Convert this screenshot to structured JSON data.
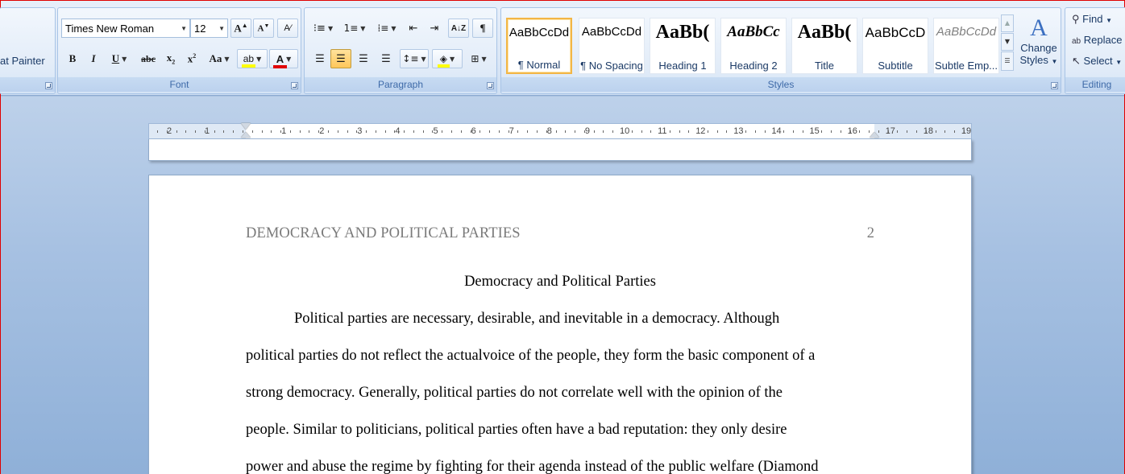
{
  "clipboard": {
    "format_painter_label": "at Painter"
  },
  "font": {
    "name": "Times New Roman",
    "size": "12",
    "group_label": "Font"
  },
  "paragraph": {
    "group_label": "Paragraph"
  },
  "styles": {
    "group_label": "Styles",
    "items": [
      {
        "sample": "AaBbCcDd",
        "name": "¶ Normal"
      },
      {
        "sample": "AaBbCcDd",
        "name": "¶ No Spacing"
      },
      {
        "sample": "AaBb(",
        "name": "Heading 1"
      },
      {
        "sample": "AaBbCc",
        "name": "Heading 2"
      },
      {
        "sample": "AaBb(",
        "name": "Title"
      },
      {
        "sample": "AaBbCcD",
        "name": "Subtitle"
      },
      {
        "sample": "AaBbCcDd",
        "name": "Subtle Emp..."
      }
    ],
    "change_styles_line1": "Change",
    "change_styles_line2": "Styles"
  },
  "editing": {
    "group_label": "Editing",
    "find": "Find",
    "replace": "Replace",
    "select": "Select"
  },
  "ruler": {
    "left_labels": [
      "2",
      "1"
    ],
    "labels": [
      "1",
      "2",
      "3",
      "4",
      "5",
      "6",
      "7",
      "8",
      "9",
      "10",
      "11",
      "12",
      "13",
      "14",
      "15",
      "16",
      "17",
      "18",
      "19"
    ]
  },
  "document": {
    "running_head": "DEMOCRACY AND POLITICAL PARTIES",
    "page_number": "2",
    "title": "Democracy and Political Parties",
    "lines": [
      "Political parties are necessary, desirable, and inevitable in a democracy. Although",
      "political parties do not reflect the actualvoice of the people, they form the basic component of a",
      "strong democracy. Generally, political parties do not correlate well with the opinion of the",
      "people. Similar to politicians, political parties often have a bad reputation: they only desire",
      "power and abuse the regime by fighting for their agenda instead of the public welfare (Diamond"
    ]
  },
  "colors": {
    "highlight": "#ffff00",
    "font_color": "#e00000",
    "accent": "#15428b"
  }
}
